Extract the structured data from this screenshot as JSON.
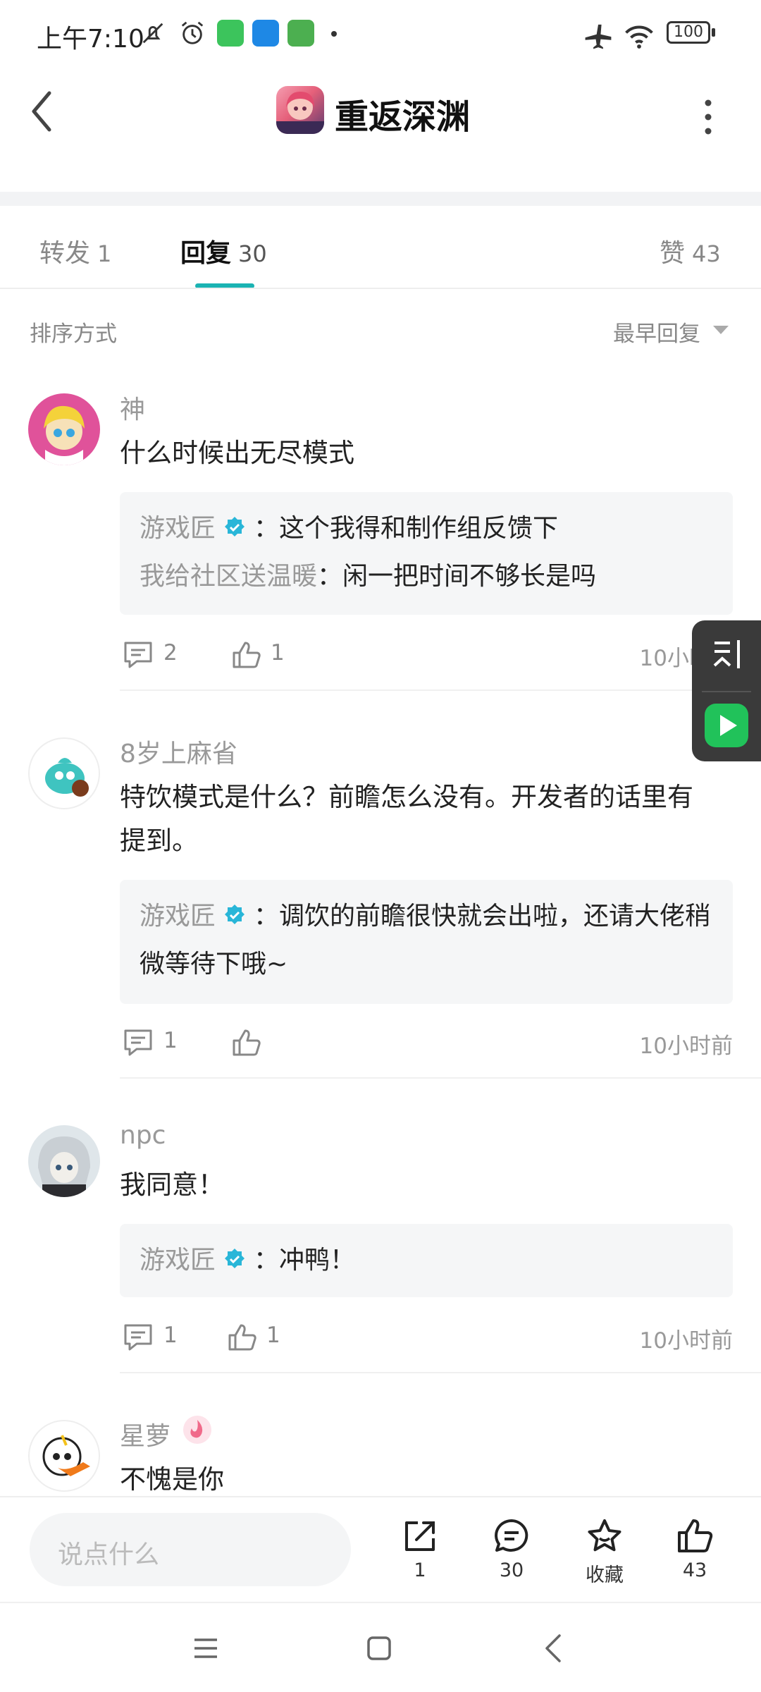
{
  "status_bar": {
    "time": "上午7:10",
    "battery": "100",
    "icons": [
      "mute-icon",
      "alarm-icon",
      "app-icon-green",
      "app-icon-blue",
      "app-icon-green2",
      "dot-icon",
      "airplane-icon",
      "wifi-icon",
      "battery-icon"
    ]
  },
  "header": {
    "title": "重返深渊",
    "back_icon": "back-arrow-icon",
    "more_icon": "more-vertical-icon"
  },
  "tabs": [
    {
      "label": "转发",
      "count": "1"
    },
    {
      "label": "回复",
      "count": "30",
      "active": true
    },
    {
      "label": "赞",
      "count": "43"
    }
  ],
  "sort": {
    "label": "排序方式",
    "value": "最早回复"
  },
  "comments": [
    {
      "user": "神",
      "text": "什么时候出无尽模式",
      "replies": [
        {
          "name": "游戏匠",
          "verified": true,
          "text": "：这个我得和制作组反馈下"
        },
        {
          "name": "我给社区送温暖",
          "verified": false,
          "text": "：闲一把时间不够长是吗"
        }
      ],
      "reply_count": "2",
      "like_count": "1",
      "time": "10小时前"
    },
    {
      "user": "8岁上麻省",
      "text": "特饮模式是什么？前瞻怎么没有。开发者的话里有提到。",
      "replies": [
        {
          "name": "游戏匠",
          "verified": true,
          "text": "：调饮的前瞻很快就会出啦，还请大佬稍微等待下哦~"
        }
      ],
      "reply_count": "1",
      "like_count": "",
      "time": "10小时前"
    },
    {
      "user": "npc",
      "text": "我同意！",
      "replies": [
        {
          "name": "游戏匠",
          "verified": true,
          "text": "：冲鸭！"
        }
      ],
      "reply_count": "1",
      "like_count": "1",
      "time": "10小时前"
    },
    {
      "user": "星萝",
      "text": "不愧是你"
    }
  ],
  "bottom_bar": {
    "input_placeholder": "说点什么",
    "share_count": "1",
    "comment_count": "30",
    "favorite_label": "收藏",
    "like_count": "43"
  },
  "colors": {
    "accent": "#1bb3b3",
    "verified": "#29b6d8",
    "float_bg": "#3a3a3a",
    "float_green": "#21c25a"
  }
}
